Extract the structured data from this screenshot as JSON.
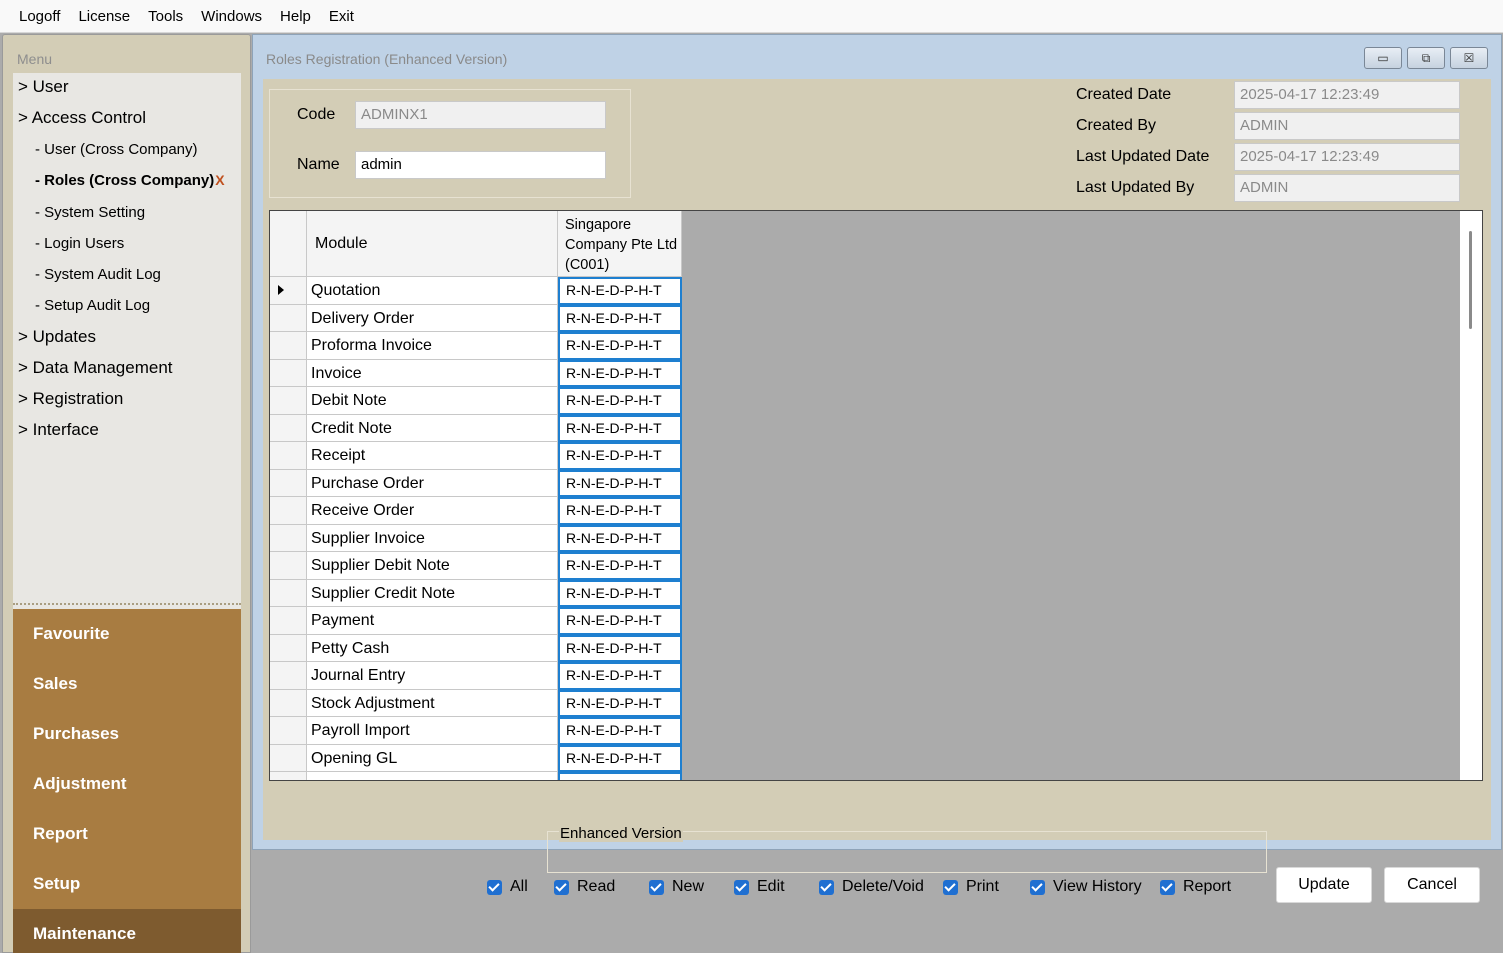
{
  "menubar": [
    "Logoff",
    "License",
    "Tools",
    "Windows",
    "Help",
    "Exit"
  ],
  "left_panel": {
    "title": "Menu",
    "tree": [
      {
        "type": "node",
        "label": "> User"
      },
      {
        "type": "node",
        "label": "> Access Control"
      },
      {
        "type": "leaf",
        "label": "- User (Cross Company)"
      },
      {
        "type": "leaf",
        "label": "- Roles (Cross Company)",
        "selected": true
      },
      {
        "type": "leaf",
        "label": "- System Setting"
      },
      {
        "type": "leaf",
        "label": "- Login Users"
      },
      {
        "type": "leaf",
        "label": "- System Audit Log"
      },
      {
        "type": "leaf",
        "label": "- Setup Audit Log"
      },
      {
        "type": "node",
        "label": "> Updates"
      },
      {
        "type": "node",
        "label": "> Data Management"
      },
      {
        "type": "node",
        "label": "> Registration"
      },
      {
        "type": "node",
        "label": "> Interface"
      }
    ],
    "close_mark": "X",
    "categories": [
      {
        "label": "Favourite"
      },
      {
        "label": "Sales"
      },
      {
        "label": "Purchases"
      },
      {
        "label": "Adjustment"
      },
      {
        "label": "Report"
      },
      {
        "label": "Setup"
      },
      {
        "label": "Maintenance",
        "active": true
      }
    ]
  },
  "window": {
    "title": "Roles Registration (Enhanced Version)",
    "buttons": {
      "minimize": "▭",
      "restore": "⧉",
      "close": "☒"
    },
    "code_label": "Code",
    "code_value": "ADMINX1",
    "name_label": "Name",
    "name_value": "admin",
    "meta": [
      {
        "label": "Created Date",
        "value": "2025-04-17 12:23:49"
      },
      {
        "label": "Created By",
        "value": "ADMIN"
      },
      {
        "label": "Last Updated Date",
        "value": "2025-04-17 12:23:49"
      },
      {
        "label": "Last Updated By",
        "value": "ADMIN"
      }
    ],
    "grid": {
      "col_module": "Module",
      "col_company": "Singapore Company Pte Ltd (C001)",
      "rows": [
        {
          "module": "Quotation",
          "perm": "R-N-E-D-P-H-T"
        },
        {
          "module": "Delivery Order",
          "perm": "R-N-E-D-P-H-T"
        },
        {
          "module": "Proforma Invoice",
          "perm": "R-N-E-D-P-H-T"
        },
        {
          "module": "Invoice",
          "perm": "R-N-E-D-P-H-T"
        },
        {
          "module": "Debit Note",
          "perm": "R-N-E-D-P-H-T"
        },
        {
          "module": "Credit Note",
          "perm": "R-N-E-D-P-H-T"
        },
        {
          "module": "Receipt",
          "perm": "R-N-E-D-P-H-T"
        },
        {
          "module": "Purchase Order",
          "perm": "R-N-E-D-P-H-T"
        },
        {
          "module": "Receive Order",
          "perm": "R-N-E-D-P-H-T"
        },
        {
          "module": "Supplier Invoice",
          "perm": "R-N-E-D-P-H-T"
        },
        {
          "module": "Supplier Debit Note",
          "perm": "R-N-E-D-P-H-T"
        },
        {
          "module": "Supplier Credit Note",
          "perm": "R-N-E-D-P-H-T"
        },
        {
          "module": "Payment",
          "perm": "R-N-E-D-P-H-T"
        },
        {
          "module": "Petty Cash",
          "perm": "R-N-E-D-P-H-T"
        },
        {
          "module": "Journal Entry",
          "perm": "R-N-E-D-P-H-T"
        },
        {
          "module": "Stock Adjustment",
          "perm": "R-N-E-D-P-H-T"
        },
        {
          "module": "Payroll Import",
          "perm": "R-N-E-D-P-H-T"
        },
        {
          "module": "Opening GL",
          "perm": "R-N-E-D-P-H-T"
        }
      ]
    },
    "enhanced_label": "Enhanced Version",
    "checks": [
      {
        "label": "All",
        "checked": true
      },
      {
        "label": "Read",
        "checked": true
      },
      {
        "label": "New",
        "checked": true
      },
      {
        "label": "Edit",
        "checked": true
      },
      {
        "label": "Delete/Void",
        "checked": true
      },
      {
        "label": "Print",
        "checked": true
      },
      {
        "label": "View History",
        "checked": true
      },
      {
        "label": "Report",
        "checked": true
      }
    ],
    "update_label": "Update",
    "cancel_label": "Cancel"
  },
  "colors": {
    "panel_bg": "#d3cdb6",
    "category_bg": "#a87c41",
    "category_active": "#7e5b2f",
    "accent_blue": "#1f6fd1",
    "window_frame": "#bfd2e6",
    "close_mark": "#c0511f"
  },
  "icons": {
    "row_pointer": "row-pointer-icon",
    "checkbox": "checkbox-checked-icon"
  }
}
